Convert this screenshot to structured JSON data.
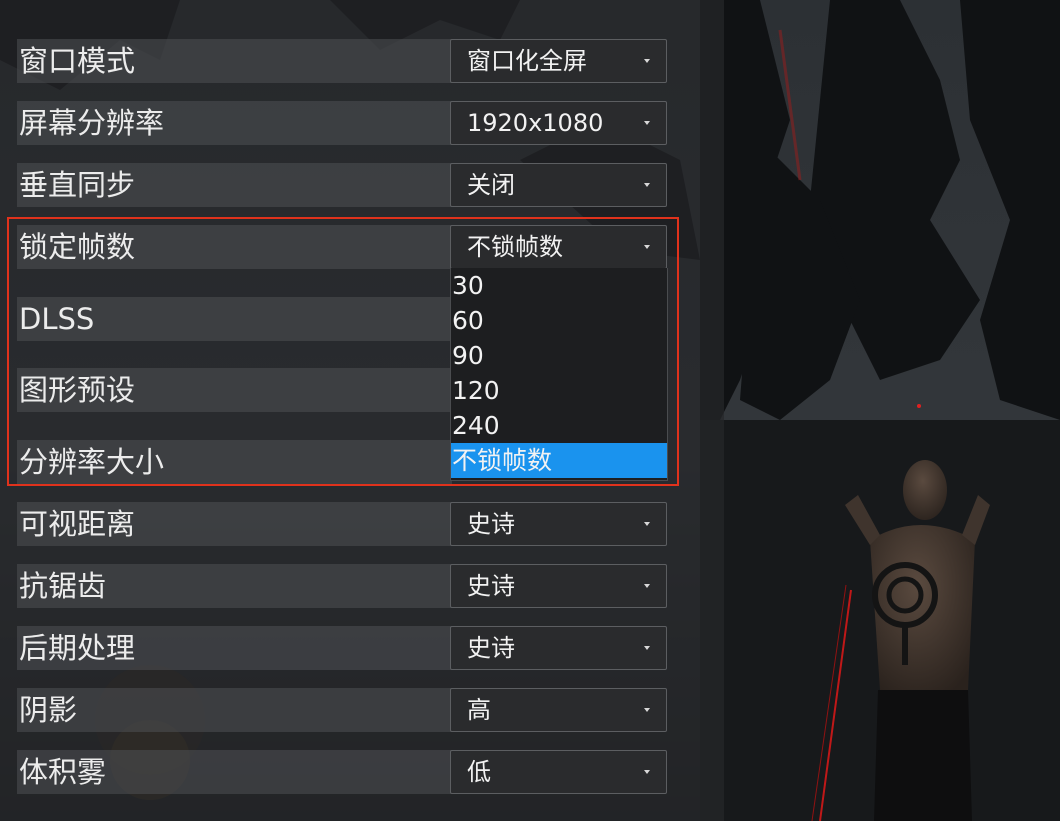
{
  "settings": [
    {
      "label": "窗口模式",
      "value": "窗口化全屏"
    },
    {
      "label": "屏幕分辨率",
      "value": "1920x1080"
    },
    {
      "label": "垂直同步",
      "value": "关闭"
    },
    {
      "label": "锁定帧数",
      "value": "不锁帧数"
    },
    {
      "label": "DLSS"
    },
    {
      "label": "图形预设"
    },
    {
      "label": "分辨率大小"
    },
    {
      "label": "可视距离",
      "value": "史诗"
    },
    {
      "label": "抗锯齿",
      "value": "史诗"
    },
    {
      "label": "后期处理",
      "value": "史诗"
    },
    {
      "label": "阴影",
      "value": "高"
    },
    {
      "label": "体积雾",
      "value": "低"
    }
  ],
  "fps_options": {
    "items": [
      "30",
      "60",
      "90",
      "120",
      "240",
      "不锁帧数"
    ],
    "selected": "不锁帧数"
  },
  "colors": {
    "highlight": "#e0321c",
    "selected_option": "#1a93ee"
  },
  "icons": [
    "chevron-down-icon"
  ]
}
